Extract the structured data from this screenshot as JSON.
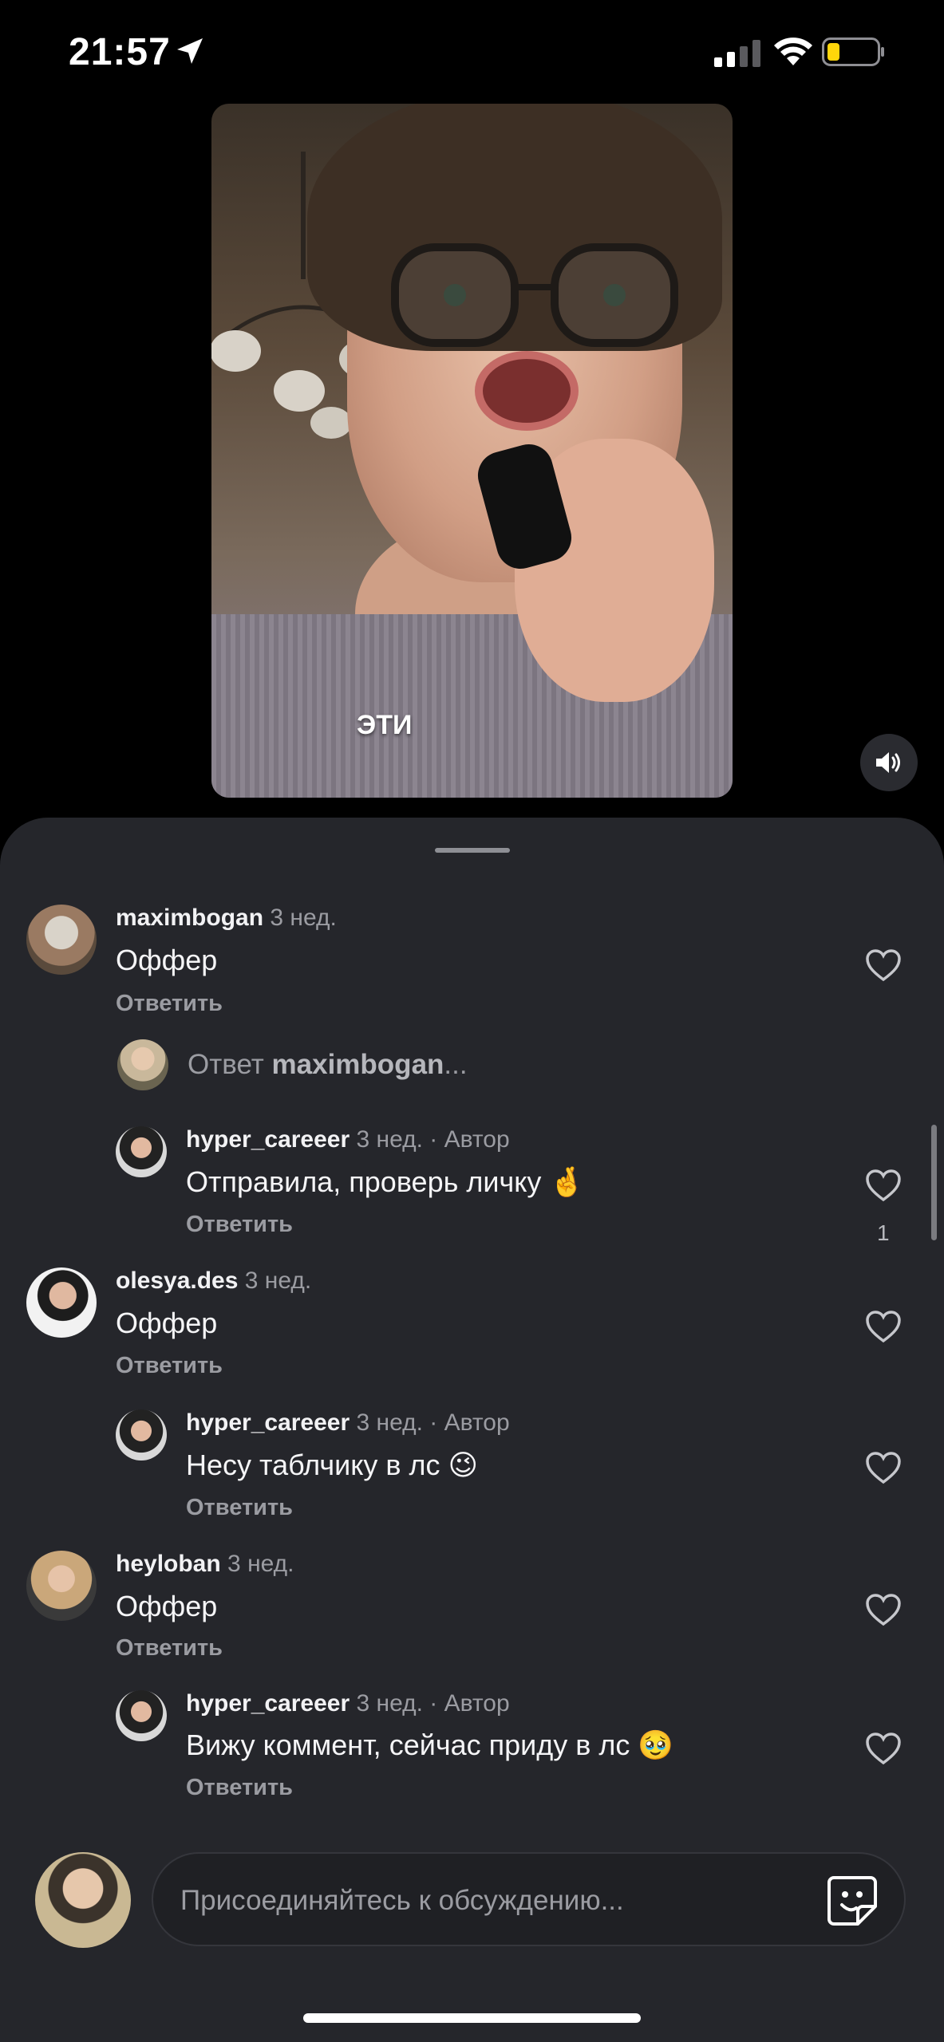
{
  "status_bar": {
    "time": "21:57"
  },
  "video": {
    "caption": "ЭТИ"
  },
  "comments": [
    {
      "user": "maximbogan",
      "ago": "3 нед.",
      "text": "Оффер",
      "reply_label": "Ответить"
    },
    {
      "user": "hyper_careeer",
      "ago": "3 нед. · Автор",
      "text": "Отправила, проверь личку 🤞",
      "reply_label": "Ответить",
      "likes": "1"
    },
    {
      "user": "olesya.des",
      "ago": "3 нед.",
      "text": "Оффер",
      "reply_label": "Ответить"
    },
    {
      "user": "hyper_careeer",
      "ago": "3 нед. · Автор",
      "text": "Несу таблчику в лс 😉",
      "reply_label": "Ответить"
    },
    {
      "user": "heyloban",
      "ago": "3 нед.",
      "text": "Оффер",
      "reply_label": "Ответить"
    },
    {
      "user": "hyper_careeer",
      "ago": "3 нед. · Автор",
      "text": "Вижу коммент, сейчас приду в лс 🥹",
      "reply_label": "Ответить"
    }
  ],
  "reply_prompt": {
    "prefix": "Ответ",
    "user": "maximbogan",
    "suffix": "..."
  },
  "input": {
    "placeholder": "Присоединяйтесь к обсуждению..."
  },
  "icons": {
    "location": "location-arrow-icon",
    "signal": "cellular-signal-icon",
    "wifi": "wifi-icon",
    "battery": "battery-low-icon",
    "sound": "speaker-icon",
    "like": "heart-icon",
    "sticker": "sticker-icon"
  },
  "colors": {
    "sheet_bg": "#25262b",
    "battery_fill": "#ffd60a",
    "muted_text": "#9b9ca2"
  }
}
